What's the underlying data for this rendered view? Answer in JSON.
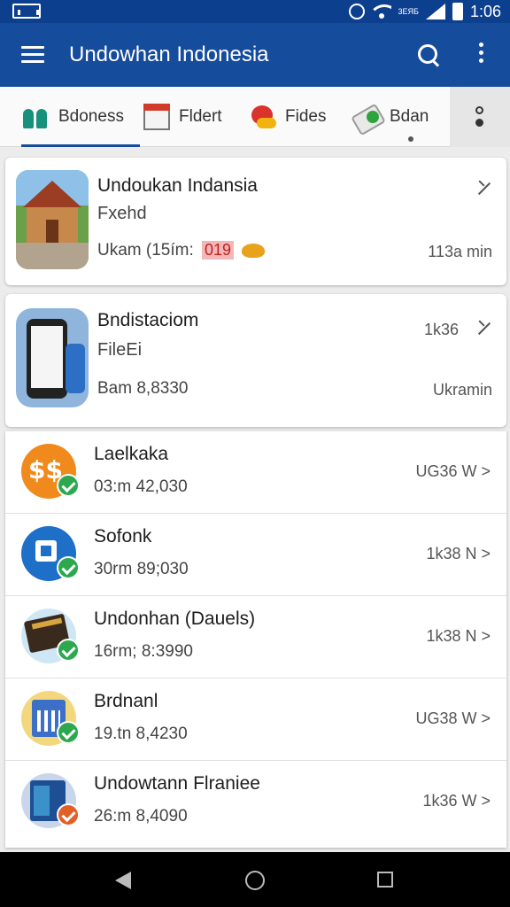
{
  "status_bar": {
    "network": "3ЕЯБ",
    "time": "1:06"
  },
  "app_bar": {
    "title": "Undowhan Indonesia"
  },
  "tabs": [
    {
      "label": "Bdoness"
    },
    {
      "label": "Fldert"
    },
    {
      "label": "Fides"
    },
    {
      "label": "Bdan"
    }
  ],
  "cards": [
    {
      "title": "Undoukan Indansia",
      "subtitle": "Fxehd",
      "meta": "Ukam (15ím:",
      "meta_badge": "019",
      "right_meta": "113a min"
    },
    {
      "title": "Bndistaciom",
      "subtitle": "FileEi",
      "meta": "Bam 8,8330",
      "right_top": "1k36",
      "right_meta": "Ukramin"
    }
  ],
  "list_items": [
    {
      "title": "Laelkaka",
      "subtitle": "03:m 42,030",
      "right": "UG36 W >",
      "check": "green"
    },
    {
      "title": "Sofonk",
      "subtitle": "30rm 89;030",
      "right": "1k38 N >",
      "check": "green"
    },
    {
      "title": "Undonhan (Dauels)",
      "subtitle": "16rm; 8:3990",
      "right": "1k38 N >",
      "check": "green"
    },
    {
      "title": "Brdnanl",
      "subtitle": "19.tn 8,4230",
      "right": "UG38 W >",
      "check": "green"
    },
    {
      "title": "Undowtann Flraniee",
      "subtitle": "26:m 8,4090",
      "right": "1k36 W >",
      "check": "orange"
    }
  ]
}
